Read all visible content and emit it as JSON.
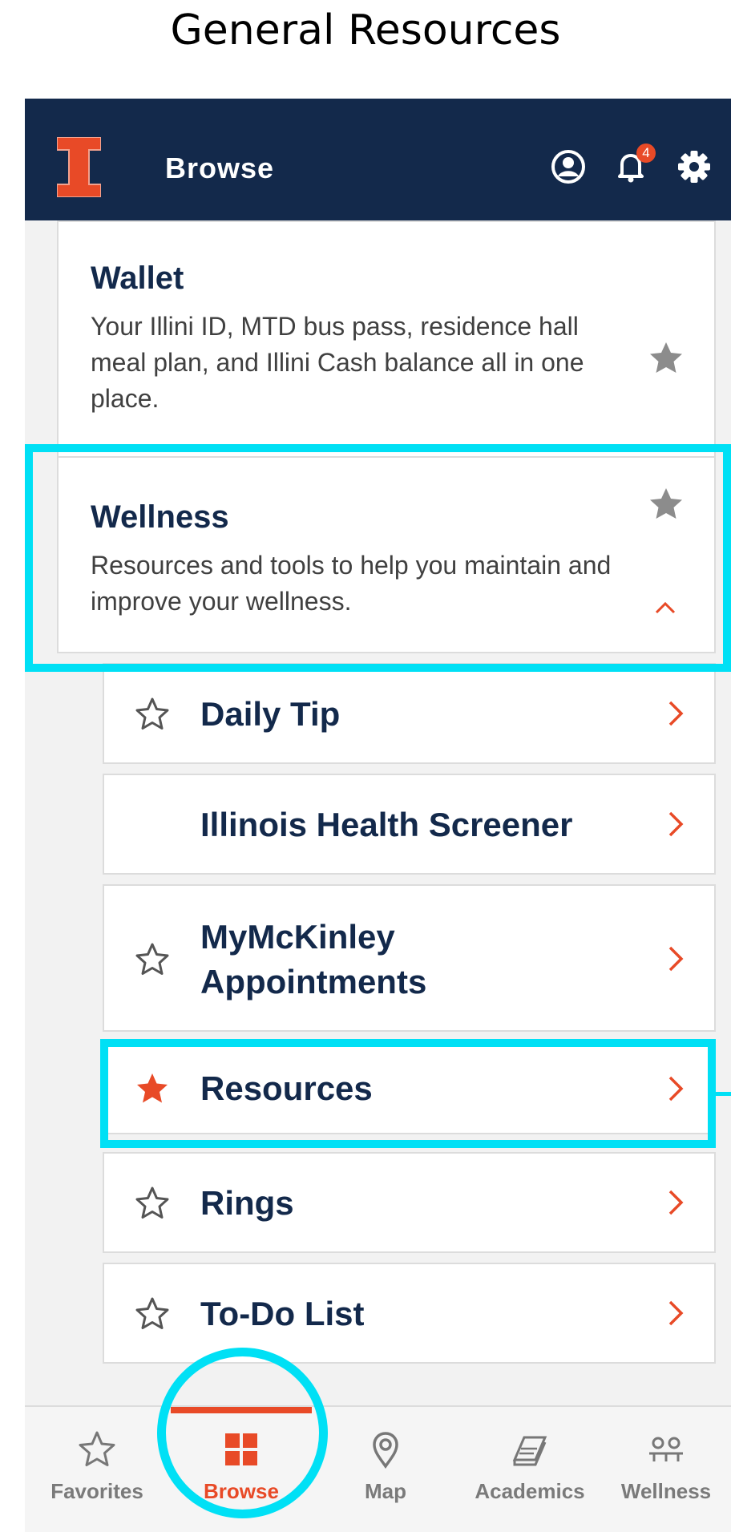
{
  "caption": "General Resources",
  "header": {
    "title": "Browse",
    "notification_count": "4"
  },
  "wallet": {
    "title": "Wallet",
    "description": "Your Illini ID, MTD bus pass, residence hall meal plan, and Illini Cash balance all in one place."
  },
  "wellness": {
    "title": "Wellness",
    "description": "Resources and tools to help you maintain and improve your wellness."
  },
  "items": [
    {
      "label": "Daily Tip",
      "favorite": false,
      "has_star": true
    },
    {
      "label": "Illinois Health Screener",
      "favorite": false,
      "has_star": false
    },
    {
      "label": "MyMcKinley Appointments",
      "favorite": false,
      "has_star": true
    },
    {
      "label": "Resources",
      "favorite": true,
      "has_star": true
    },
    {
      "label": "Rings",
      "favorite": false,
      "has_star": true
    },
    {
      "label": "To-Do List",
      "favorite": false,
      "has_star": true
    }
  ],
  "tabs": [
    {
      "label": "Favorites",
      "icon": "star-icon"
    },
    {
      "label": "Browse",
      "icon": "grid-icon",
      "active": true
    },
    {
      "label": "Map",
      "icon": "map-pin-icon"
    },
    {
      "label": "Academics",
      "icon": "book-icon"
    },
    {
      "label": "Wellness",
      "icon": "wellness-icon"
    }
  ],
  "colors": {
    "navy": "#13294b",
    "orange": "#e84a27",
    "highlight": "#00e0f5"
  }
}
